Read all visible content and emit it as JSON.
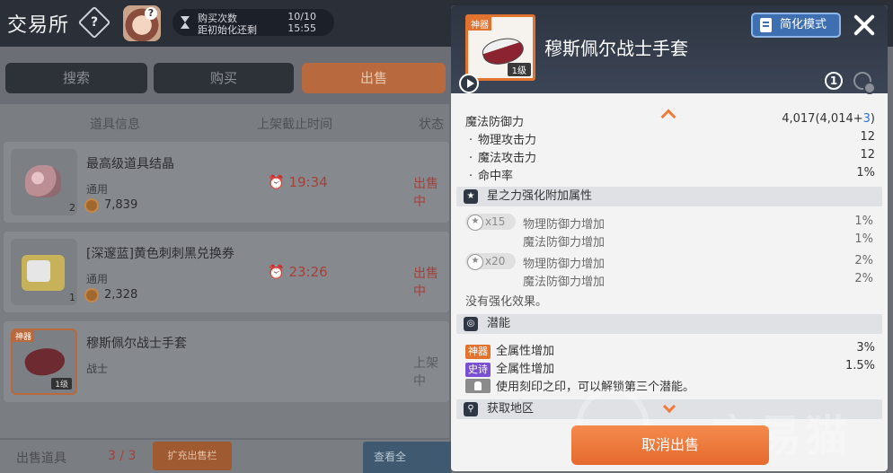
{
  "header": {
    "title": "交易所",
    "help": "?",
    "timer": {
      "label1": "购买次数",
      "value1": "10/10",
      "label2": "距初始化还剩",
      "value2": "15:55"
    }
  },
  "tabs": [
    {
      "label": "搜索"
    },
    {
      "label": "购买"
    },
    {
      "label": "出售"
    }
  ],
  "columns": {
    "info": "道具信息",
    "deadline": "上架截止时间",
    "status": "状态"
  },
  "listings": [
    {
      "name": "最高级道具结晶",
      "sub": "通用",
      "price": "7,839",
      "count": "2",
      "deadline": "19:34",
      "status": "出售中"
    },
    {
      "name": "[深邃蓝]黄色刺刺黑兑换券",
      "sub": "通用",
      "price": "2,328",
      "count": "1",
      "deadline": "23:26",
      "status": "出售中"
    },
    {
      "name": "穆斯佩尔战士手套",
      "sub": "战士",
      "badge": "神器",
      "level": "1级",
      "status": "上架中"
    }
  ],
  "footer": {
    "sell_label": "出售道具",
    "sell_count": "3 / 3",
    "expand": "扩充出售栏",
    "check": "查看全"
  },
  "detail": {
    "badge": "神器",
    "level": "1级",
    "title": "穆斯佩尔战士手套",
    "simple_mode": "简化模式",
    "num_icon": "1",
    "main_stat": {
      "name": "魔法防御力",
      "value": "4,017(4,014+",
      "bonus": "3",
      "close": ")"
    },
    "sub_stats": [
      {
        "name": "物理攻击力",
        "value": "12"
      },
      {
        "name": "魔法攻击力",
        "value": "12"
      },
      {
        "name": "命中率",
        "value": "1%"
      }
    ],
    "star_section": "星之力强化附加属性",
    "star_tiers": [
      {
        "tier": "x15",
        "stats": [
          {
            "name": "物理防御力增加",
            "value": "1%"
          },
          {
            "name": "魔法防御力增加",
            "value": "1%"
          }
        ]
      },
      {
        "tier": "x20",
        "stats": [
          {
            "name": "物理防御力增加",
            "value": "2%"
          },
          {
            "name": "魔法防御力增加",
            "value": "2%"
          }
        ]
      }
    ],
    "no_enhance": "没有强化效果。",
    "potential_section": "潜能",
    "potentials": [
      {
        "grade": "神器",
        "name": "全属性增加",
        "value": "3%"
      },
      {
        "grade": "史诗",
        "name": "全属性增加",
        "value": "1.5%"
      }
    ],
    "unlock_hint": "使用刻印之印，可以解锁第三个潜能。",
    "region_section": "获取地区",
    "cancel": "取消出售",
    "watermark": "交易猫"
  },
  "colors": {
    "accent": "#e56a2e",
    "legend": "#e1732f",
    "epic": "#7a4fd1",
    "bonus": "#2f74d6",
    "panel_head": "#2e3542"
  }
}
